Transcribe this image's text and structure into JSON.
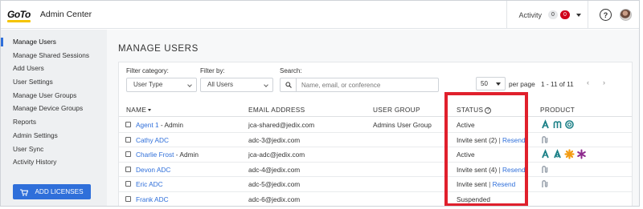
{
  "app": {
    "logo_text": "GoTo",
    "title": "Admin Center"
  },
  "topbar": {
    "activity_label": "Activity",
    "activity_count": "0",
    "alert_count": "0",
    "help_label": "?"
  },
  "sidebar": {
    "items": [
      {
        "label": "Manage Users",
        "active": true
      },
      {
        "label": "Manage Shared Sessions"
      },
      {
        "label": "Add Users"
      },
      {
        "label": "User Settings"
      },
      {
        "label": "Manage User Groups"
      },
      {
        "label": "Manage Device Groups"
      },
      {
        "label": "Reports"
      },
      {
        "label": "Admin Settings"
      },
      {
        "label": "User Sync"
      },
      {
        "label": "Activity History"
      }
    ],
    "add_licenses_label": "ADD LICENSES"
  },
  "main": {
    "page_title": "MANAGE USERS",
    "filters": {
      "category_label": "Filter category:",
      "category_value": "User Type",
      "filter_by_label": "Filter by:",
      "filter_by_value": "All Users",
      "search_label": "Search:",
      "search_placeholder": "Name, email, or conference"
    },
    "pagination": {
      "per_page_value": "50",
      "per_page_label": "per page",
      "range": "1 - 11 of 11",
      "prev": "‹",
      "next": "›"
    },
    "table": {
      "headers": {
        "name": "NAME",
        "email": "EMAIL ADDRESS",
        "group": "USER GROUP",
        "status": "STATUS",
        "product": "PRODUCT"
      },
      "rows": [
        {
          "name": "Agent 1",
          "suffix": " - Admin",
          "email": "jca-shared@jedix.com",
          "group": "Admins User Group",
          "status": "Active",
          "resend": "",
          "products": [
            "gotoconnect",
            "gotomeeting",
            "gotoresolve"
          ]
        },
        {
          "name": "Cathy ADC",
          "suffix": "",
          "email": "adc-3@jedix.com",
          "group": "",
          "status": "Invite sent (2)",
          "resend": "Resend",
          "products": [
            "gray"
          ]
        },
        {
          "name": "Charlie Frost",
          "suffix": " - Admin",
          "email": "jca-adc@jedix.com",
          "group": "",
          "status": "Active",
          "resend": "",
          "products": [
            "gotoconnect",
            "gotoconnect2",
            "orange-star",
            "purple-star"
          ]
        },
        {
          "name": "Devon ADC",
          "suffix": "",
          "email": "adc-4@jedix.com",
          "group": "",
          "status": "Invite sent (4)",
          "resend": "Resend",
          "products": [
            "gray"
          ]
        },
        {
          "name": "Eric ADC",
          "suffix": "",
          "email": "adc-5@jedix.com",
          "group": "",
          "status": "Invite sent",
          "resend": "Resend",
          "products": [
            "gray"
          ]
        },
        {
          "name": "Frank ADC",
          "suffix": "",
          "email": "adc-6@jedix.com",
          "group": "",
          "status": "Suspended",
          "resend": "",
          "products": []
        }
      ]
    }
  },
  "colors": {
    "accent": "#2f6fda",
    "highlight": "#e0202c",
    "product_teal": "#1a7f86",
    "product_orange": "#f39c12",
    "product_purple": "#8e2a8e",
    "product_gray": "#9aa3ad"
  }
}
